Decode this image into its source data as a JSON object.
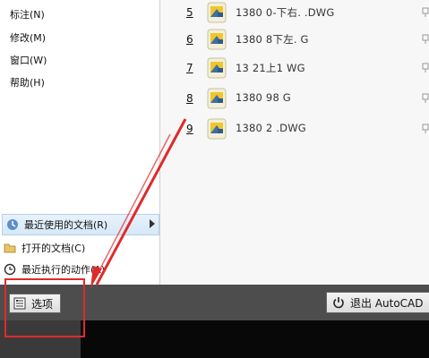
{
  "menu": {
    "items": [
      {
        "label": "标注(N)"
      },
      {
        "label": "修改(M)"
      },
      {
        "label": "窗口(W)"
      },
      {
        "label": "帮助(H)"
      }
    ],
    "recent_documents": "最近使用的文档(R)",
    "open_documents": "打开的文档(C)",
    "recent_actions": "最近执行的动作(A)"
  },
  "files": [
    {
      "num": "5",
      "name": "1380      0-下右.  .DWG"
    },
    {
      "num": "6",
      "name": "1380      8下左.    G"
    },
    {
      "num": "7",
      "name": "13         21上1    WG"
    },
    {
      "num": "8",
      "name": "1380      98     G"
    },
    {
      "num": "9",
      "name": "1380       2    .DWG"
    }
  ],
  "bottom_bar": {
    "options_label": "选项",
    "exit_label": "退出 AutoCAD"
  },
  "colors": {
    "highlight": "#e02a2a",
    "menu_hover": "#d6e8f8",
    "bottom_bar": "#4d4d4d"
  }
}
